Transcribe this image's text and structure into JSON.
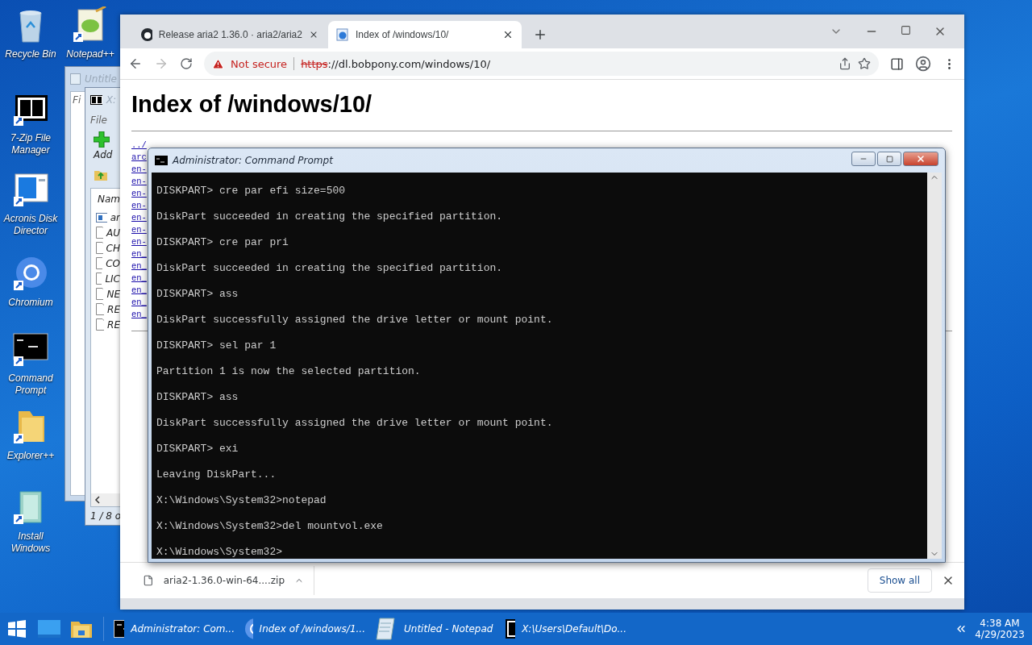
{
  "desktop_icons": [
    {
      "label": "Recycle Bin",
      "kind": "recycle"
    },
    {
      "label": "Notepad++",
      "kind": "notepadpp"
    },
    {
      "label": "7-Zip File Manager",
      "kind": "sevenzip"
    },
    {
      "label": "Acronis Disk Director",
      "kind": "acronis"
    },
    {
      "label": "Chromium",
      "kind": "chromium"
    },
    {
      "label": "Command Prompt",
      "kind": "cmd"
    },
    {
      "label": "Explorer++",
      "kind": "folder"
    },
    {
      "label": "Install Windows",
      "kind": "installer"
    }
  ],
  "notepad_window": {
    "title": "Untitle",
    "menu": "Fi"
  },
  "sevenzip_window": {
    "title": "X:",
    "menu": "File",
    "toolbar_button": "Add",
    "column": "Nam",
    "files": [
      {
        "name": "ar",
        "kind": "archive"
      },
      {
        "name": "AU",
        "kind": "file"
      },
      {
        "name": "CH",
        "kind": "file"
      },
      {
        "name": "CO",
        "kind": "file"
      },
      {
        "name": "LIC",
        "kind": "file"
      },
      {
        "name": "NE",
        "kind": "file"
      },
      {
        "name": "RE",
        "kind": "file"
      },
      {
        "name": "RE",
        "kind": "file"
      }
    ],
    "status": "1 / 8 o"
  },
  "browser": {
    "tabs": [
      {
        "title": "Release aria2 1.36.0 · aria2/aria2",
        "kind": "github",
        "selected": false
      },
      {
        "title": "Index of /windows/10/",
        "kind": "ie",
        "selected": true
      }
    ],
    "security": "Not secure",
    "url_scheme": "https",
    "url_rest": "://dl.bobpony.com/windows/10/",
    "page": {
      "heading": "Index of /windows/10/",
      "links": [
        "../",
        "arc",
        "en-",
        "en-",
        "en-",
        "en-",
        "en-",
        "en-",
        "en-",
        "en_",
        "en_",
        "en_",
        "en_",
        "en_",
        "en_"
      ]
    },
    "download": {
      "file": "aria2-1.36.0-win-64....zip",
      "show_all": "Show all"
    }
  },
  "console": {
    "title": "Administrator: Command Prompt",
    "lines": [
      "DISKPART> cre par efi size=500",
      "DiskPart succeeded in creating the specified partition.",
      "DISKPART> cre par pri",
      "DiskPart succeeded in creating the specified partition.",
      "DISKPART> ass",
      "DiskPart successfully assigned the drive letter or mount point.",
      "DISKPART> sel par 1",
      "Partition 1 is now the selected partition.",
      "DISKPART> ass",
      "DiskPart successfully assigned the drive letter or mount point.",
      "DISKPART> exi",
      "Leaving DiskPart...",
      "X:\\Windows\\System32>notepad",
      "X:\\Windows\\System32>del mountvol.exe",
      "X:\\Windows\\System32>"
    ]
  },
  "taskbar": {
    "tasks": [
      {
        "label": "Administrator: Com...",
        "kind": "cmd"
      },
      {
        "label": "Index of /windows/1...",
        "kind": "chromium"
      },
      {
        "label": "Untitled - Notepad",
        "kind": "notepad"
      },
      {
        "label": "X:\\Users\\Default\\Do...",
        "kind": "sevenzip"
      }
    ],
    "time": "4:38 AM",
    "date": "4/29/2023"
  }
}
